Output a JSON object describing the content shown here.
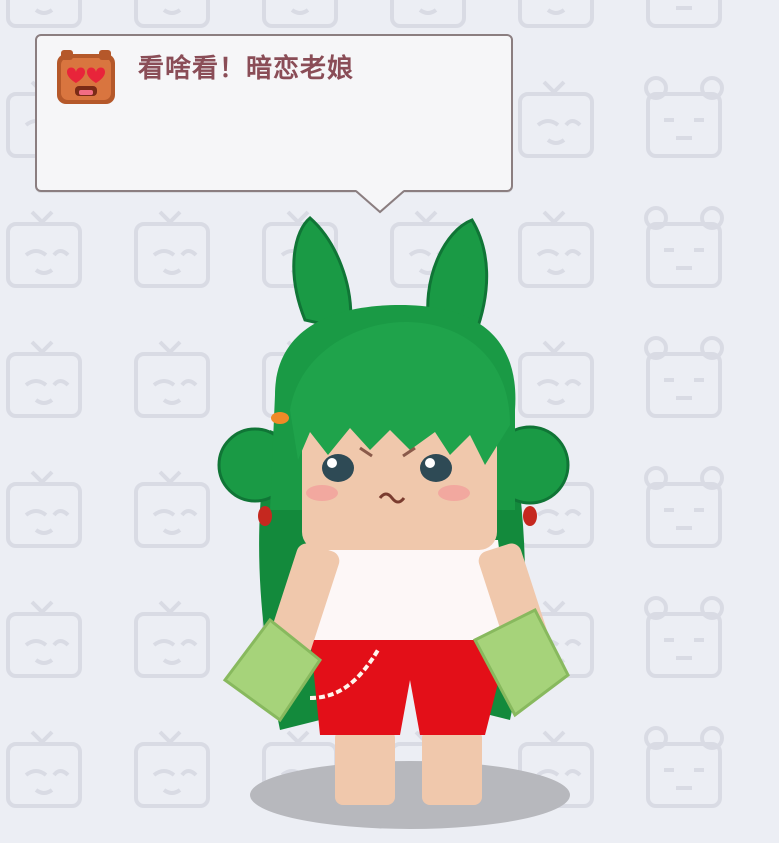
{
  "chat_bubble": {
    "message": "看啥看！暗恋老娘",
    "icon": "heart-eyes-bear-icon"
  },
  "background": {
    "pattern": "block-face-tiles",
    "color": "#eceef4"
  },
  "character": {
    "hair_color": "#1a9a45",
    "top_color": "#fdf7f7",
    "shorts_color": "#e30f18",
    "glove_color": "#a6d37a"
  }
}
